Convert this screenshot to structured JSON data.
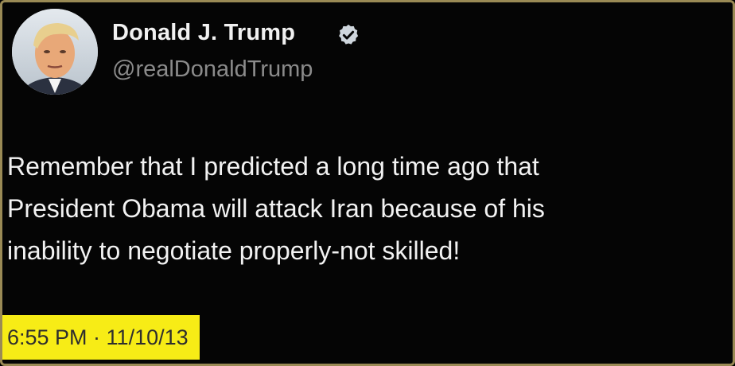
{
  "tweet": {
    "author": {
      "display_name": "Donald J. Trump",
      "handle": "@realDonaldTrump",
      "verified": true
    },
    "text_lines": [
      "Remember that I predicted a long time ago that",
      "President Obama will attack Iran because of his",
      "inability to negotiate properly-not skilled!"
    ],
    "timestamp": "6:55 PM · 11/10/13"
  },
  "colors": {
    "background": "#050505",
    "frame_border": "#9a8a55",
    "text": "#f2f2f2",
    "handle": "#8b8b8b",
    "verified_badge": "#cfd6dd",
    "timestamp_highlight": "#f7ec16"
  },
  "icons": {
    "verified": "verified-badge-icon"
  }
}
